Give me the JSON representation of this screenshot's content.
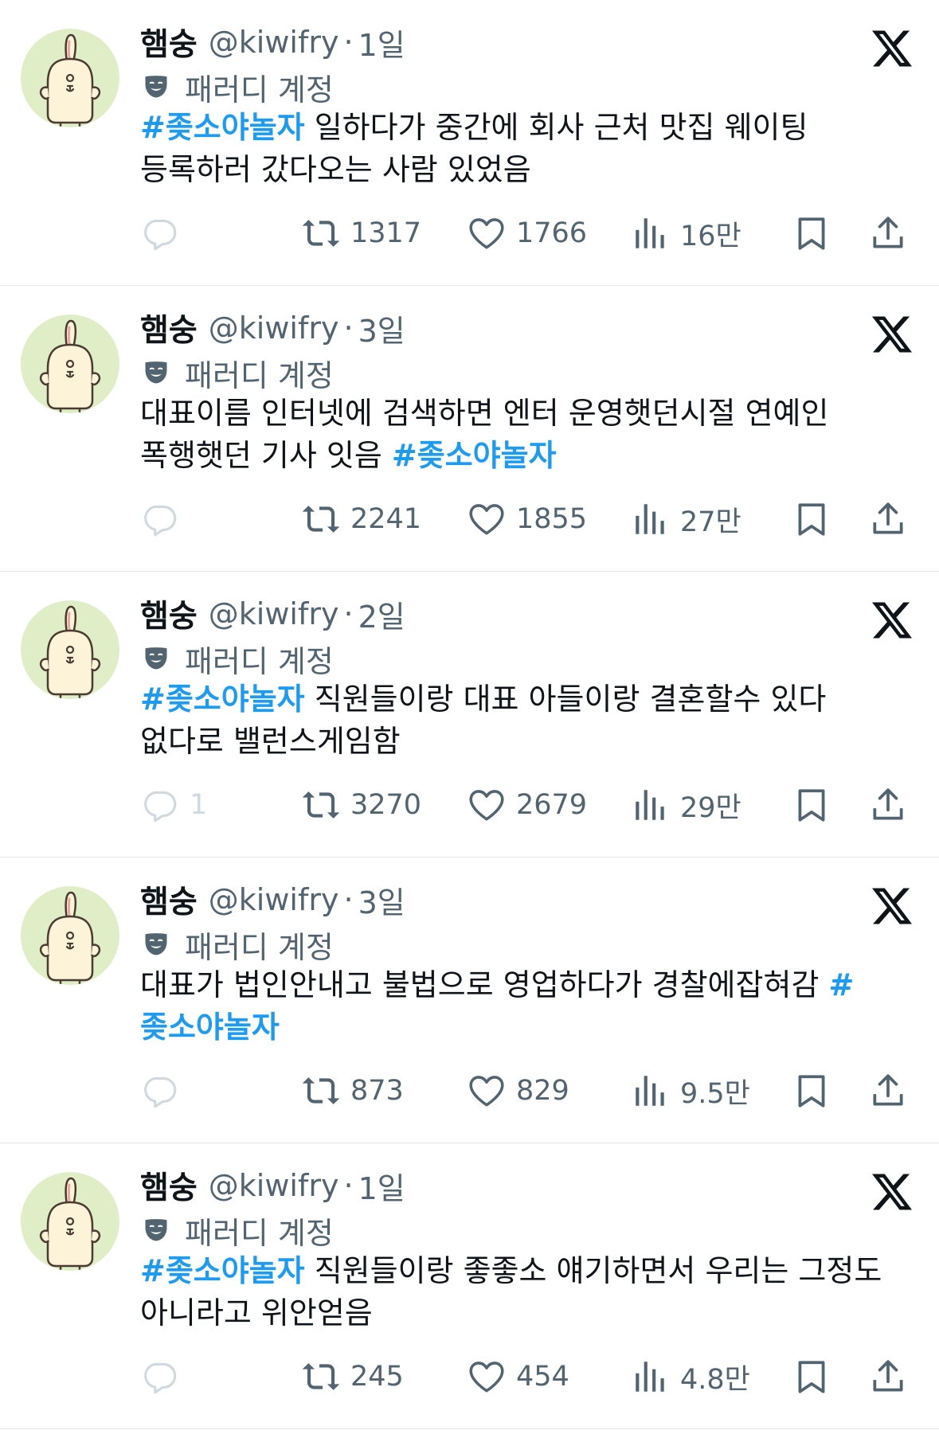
{
  "common": {
    "name": "햄숭",
    "handle": "@kiwifry",
    "dot": "·",
    "parody_label": "패러디 계정"
  },
  "tweets": [
    {
      "time": "1일",
      "segments": [
        {
          "type": "hashtag",
          "text": "#좆소야놀자"
        },
        {
          "type": "text",
          "text": " 일하다가 중간에 회사 근처 맛집 웨이팅 등록하러 갔다오는 사람 있었음"
        }
      ],
      "reply_count": "",
      "retweet_count": "1317",
      "like_count": "1766",
      "views_count": "16만"
    },
    {
      "time": "3일",
      "segments": [
        {
          "type": "text",
          "text": "대표이름 인터넷에 검색하면 엔터 운영햇던시절 연예인 폭행햇던 기사 잇음 "
        },
        {
          "type": "hashtag",
          "text": "#좆소야놀자"
        }
      ],
      "reply_count": "",
      "retweet_count": "2241",
      "like_count": "1855",
      "views_count": "27만"
    },
    {
      "time": "2일",
      "segments": [
        {
          "type": "hashtag",
          "text": "#좆소야놀자"
        },
        {
          "type": "text",
          "text": " 직원들이랑 대표 아들이랑 결혼할수 있다 없다로 밸런스게임함"
        }
      ],
      "reply_count": "1",
      "retweet_count": "3270",
      "like_count": "2679",
      "views_count": "29만"
    },
    {
      "time": "3일",
      "segments": [
        {
          "type": "text",
          "text": "대표가 법인안내고 불법으로 영업하다가 경찰에잡혀감 "
        },
        {
          "type": "hashtag",
          "text": "#좆소야놀자"
        }
      ],
      "reply_count": "",
      "retweet_count": "873",
      "like_count": "829",
      "views_count": "9.5만"
    },
    {
      "time": "1일",
      "segments": [
        {
          "type": "hashtag",
          "text": "#좆소야놀자"
        },
        {
          "type": "text",
          "text": " 직원들이랑 좋좋소 얘기하면서 우리는 그정도 아니라고 위안얻음"
        }
      ],
      "reply_count": "",
      "retweet_count": "245",
      "like_count": "454",
      "views_count": "4.8만"
    }
  ],
  "icons": {
    "avatar": "rabbit-avatar",
    "platform": "x-logo-icon",
    "parody": "theater-mask-icon",
    "reply": "reply-bubble-icon",
    "retweet": "retweet-icon",
    "like": "heart-icon",
    "views": "views-bar-icon",
    "bookmark": "bookmark-icon",
    "share": "share-icon"
  },
  "colors": {
    "hashtag": "#1d9bf0",
    "secondary_text": "#536471",
    "primary_text": "#0f1419",
    "avatar_bg": "#dfeec7",
    "divider": "#e3e6ea"
  }
}
